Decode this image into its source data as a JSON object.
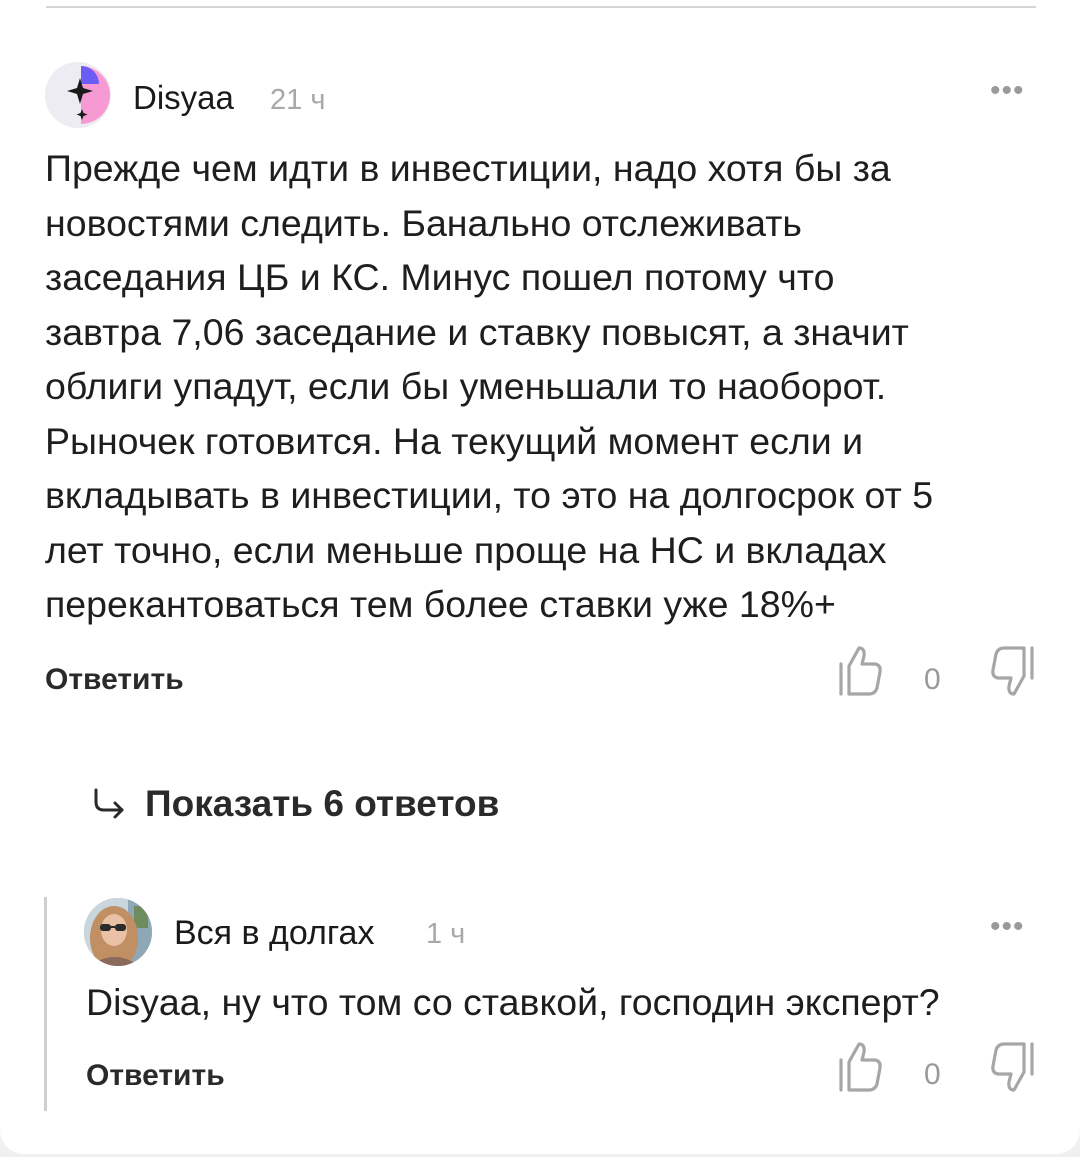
{
  "main_comment": {
    "author": "Dіsyaa",
    "time": "21 ч",
    "more": "•••",
    "text": "Прежде чем идти в инвестиции, надо хотя бы за\nновостями следить. Банально отслеживать\nзаседания ЦБ и КС. Минус пошел потому что\nзавтра 7,06 заседание и ставку повысят, а значит\nоблиги упадут, если бы уменьшали то наоборот.\nРыночек готовится. На текущий момент если и\nвкладывать в инвестиции, то это на долгосрок от 5\nлет точно, если меньше проще на НС и вкладах\nперекантоваться тем более ставки уже 18%+",
    "reply_label": "Ответить",
    "like_icon": "thumbs-up-icon",
    "vote_count": "0",
    "dislike_icon": "thumbs-down-icon"
  },
  "show_replies": {
    "icon": "arrow-down-right-icon",
    "label": "Показать 6 ответов"
  },
  "reply_comment": {
    "author": "Вся в долгах",
    "time": "1 ч",
    "more": "•••",
    "text": "Dіsyaa, ну что том со ставкой, господин эксперт?",
    "reply_label": "Ответить",
    "like_icon": "thumbs-up-icon",
    "vote_count": "0",
    "dislike_icon": "thumbs-down-icon"
  },
  "colors": {
    "text": "#1e1e1e",
    "muted": "#a8a8a8",
    "avatar_accent_purple": "#6b5cf5",
    "avatar_accent_pink": "#f79ad3"
  }
}
